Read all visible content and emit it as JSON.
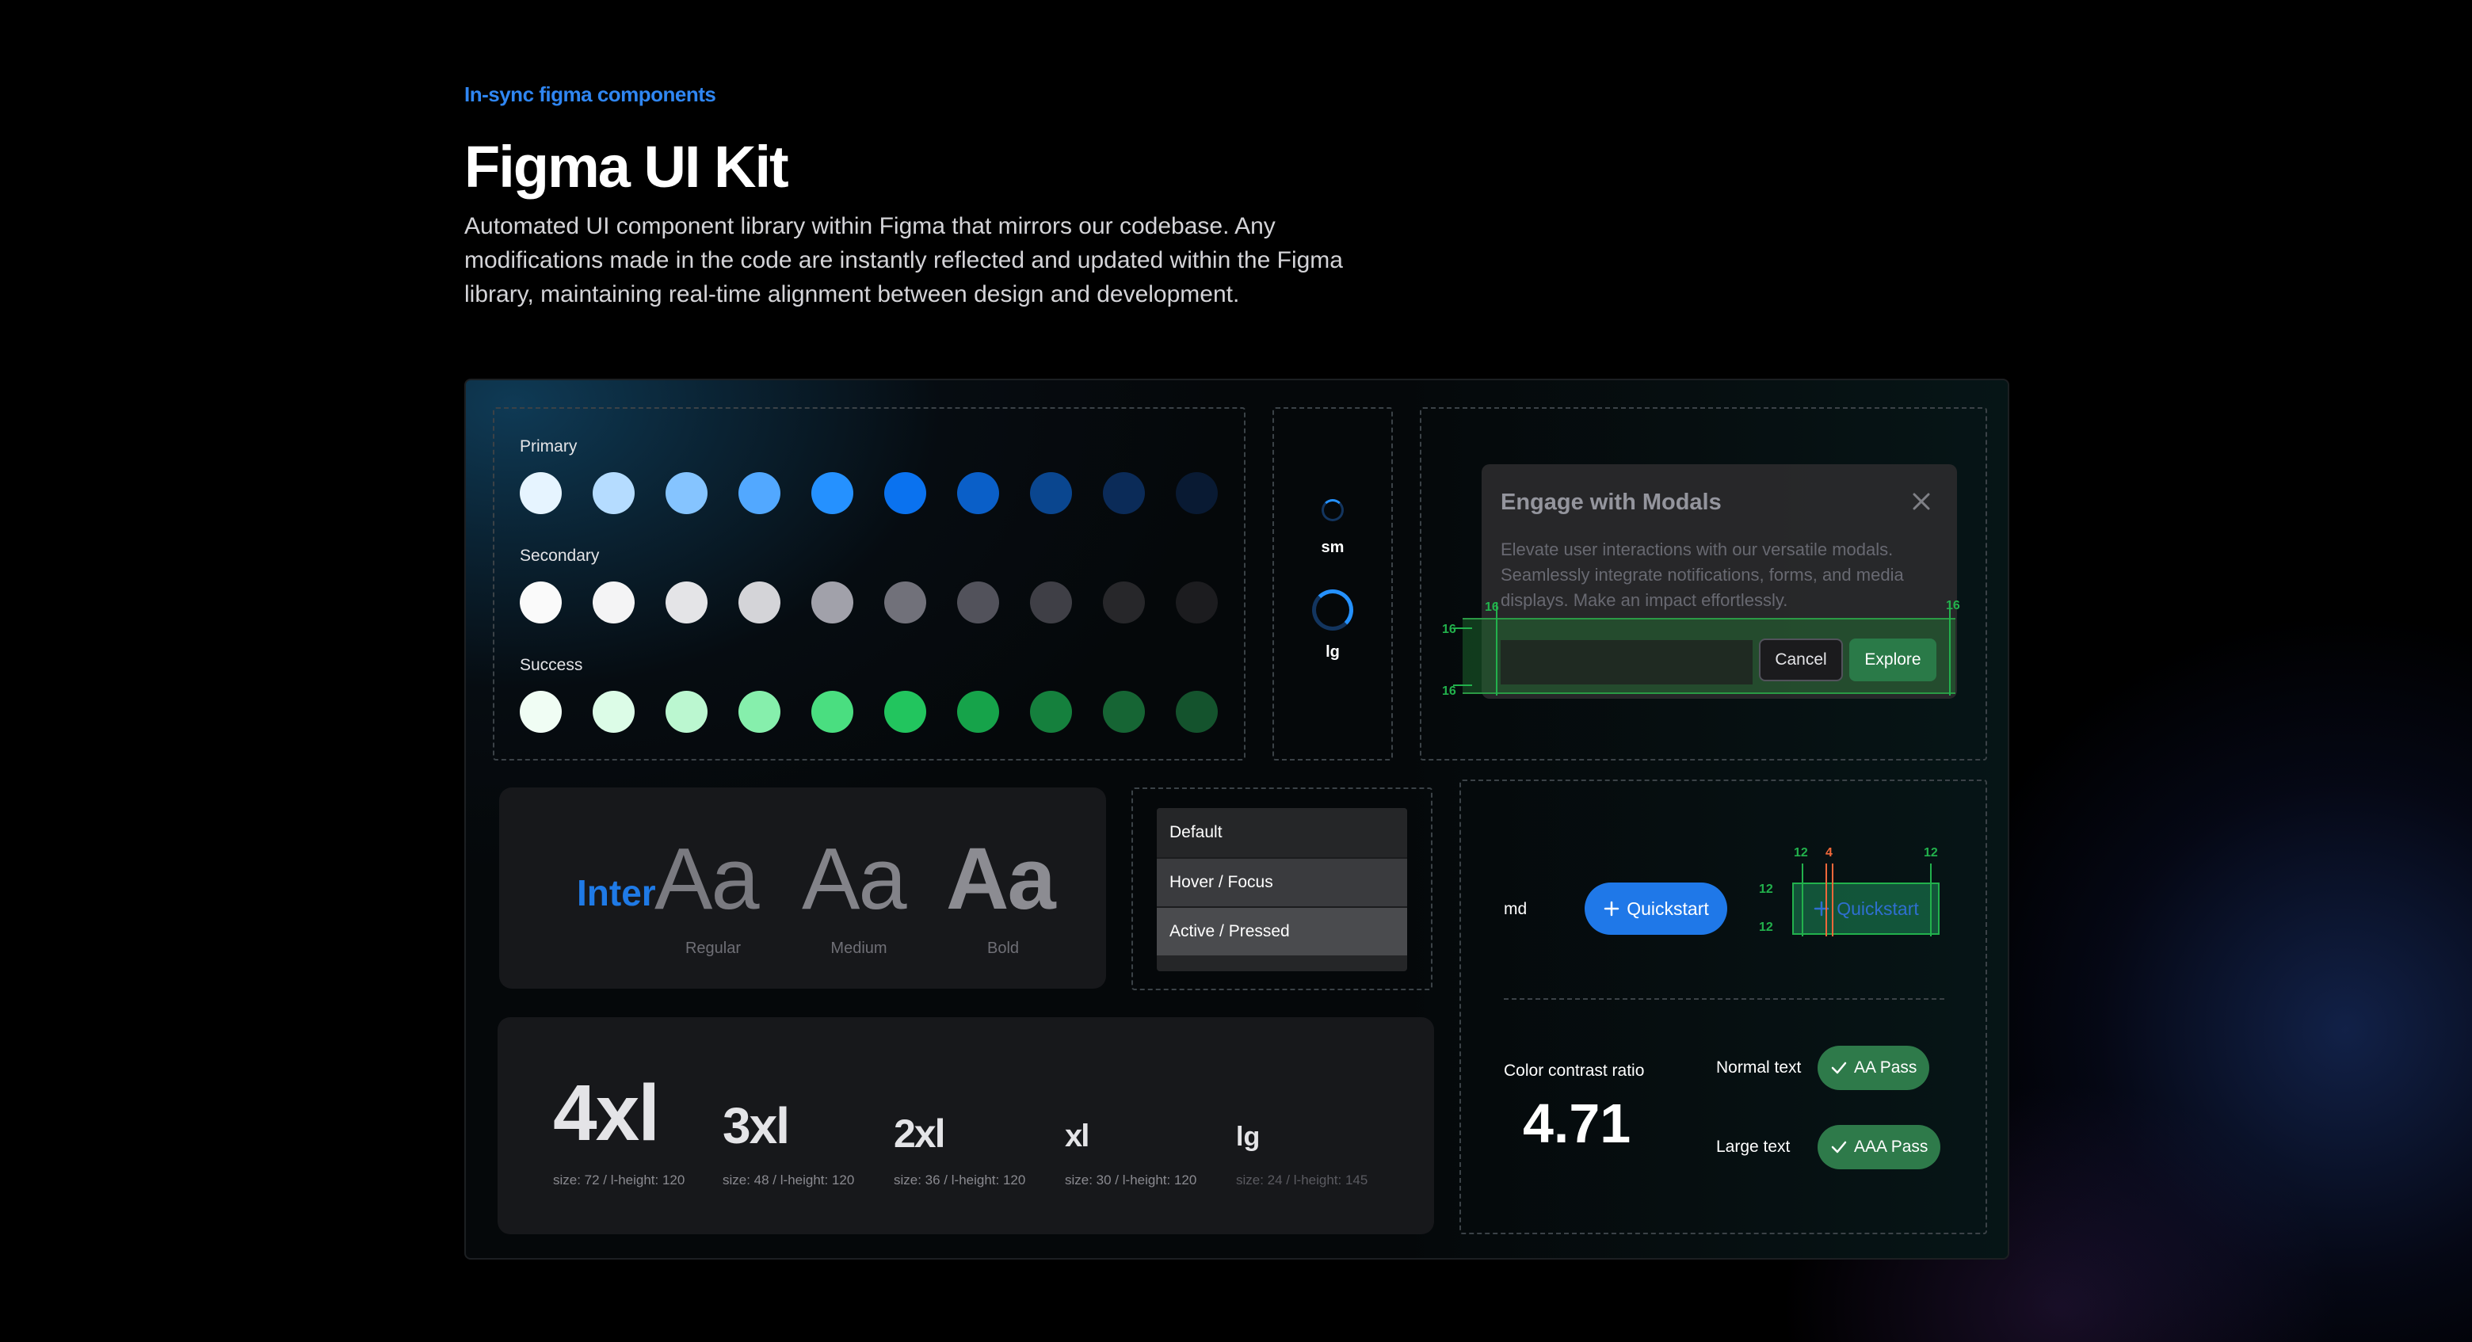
{
  "header": {
    "eyebrow": "In-sync figma components",
    "title": "Figma UI Kit",
    "description": "Automated UI component library within Figma that mirrors our codebase. Any modifications made in the code are instantly reflected and updated within the Figma library, maintaining real-time alignment between design and development."
  },
  "palette": {
    "groups": [
      {
        "label": "Primary",
        "colors": [
          "#e6f4ff",
          "#b5dcff",
          "#85c4ff",
          "#52a8ff",
          "#2591ff",
          "#0a72ef",
          "#0a5fc8",
          "#0a468f",
          "#0b2b58",
          "#091a33"
        ]
      },
      {
        "label": "Secondary",
        "colors": [
          "#fafafa",
          "#f4f4f5",
          "#e4e4e7",
          "#d4d4d8",
          "#a1a1aa",
          "#71717a",
          "#52525b",
          "#3f3f46",
          "#27272a",
          "#1c1c1f"
        ]
      },
      {
        "label": "Success",
        "colors": [
          "#f0fdf4",
          "#dcfce7",
          "#bbf7d0",
          "#86efac",
          "#4ade80",
          "#22c55e",
          "#16a34a",
          "#15803d",
          "#166534",
          "#14532d"
        ]
      }
    ]
  },
  "spinners": {
    "sm": "sm",
    "lg": "lg"
  },
  "modal": {
    "title": "Engage with Modals",
    "body": "Elevate user interactions with our versatile modals. Seamlessly integrate notifications, forms, and media displays. Make an impact effortlessly.",
    "cancel": "Cancel",
    "explore": "Explore",
    "spacing": {
      "left": "16",
      "right": "16",
      "top": "16",
      "bottom": "16"
    }
  },
  "typography": {
    "font_name": "Inter",
    "glyph": "Aa",
    "weights": [
      "Regular",
      "Medium",
      "Bold"
    ]
  },
  "dropdown": {
    "states": [
      "Default",
      "Hover / Focus",
      "Active / Pressed"
    ]
  },
  "sizes": [
    {
      "name": "4xl",
      "spec": "size: 72 / l-height: 120"
    },
    {
      "name": "3xl",
      "spec": "size: 48 / l-height: 120"
    },
    {
      "name": "2xl",
      "spec": "size: 36 / l-height: 120"
    },
    {
      "name": "xl",
      "spec": "size: 30 / l-height: 120"
    },
    {
      "name": "lg",
      "spec": "size: 24 / l-height: 145"
    }
  ],
  "button_spec": {
    "size_label": "md",
    "label": "Quickstart",
    "padding": {
      "left": "12",
      "gap": "4",
      "right": "12",
      "top": "12",
      "bottom": "12"
    }
  },
  "contrast": {
    "label": "Color contrast ratio",
    "value": "4.71",
    "normal_text": "Normal text",
    "normal_result": "AA Pass",
    "large_text": "Large text",
    "large_result": "AAA Pass"
  },
  "colors": {
    "accent": "#2f86f2",
    "success": "#2e7a4a",
    "measure_green": "#22b14c",
    "measure_orange": "#f0683a"
  }
}
